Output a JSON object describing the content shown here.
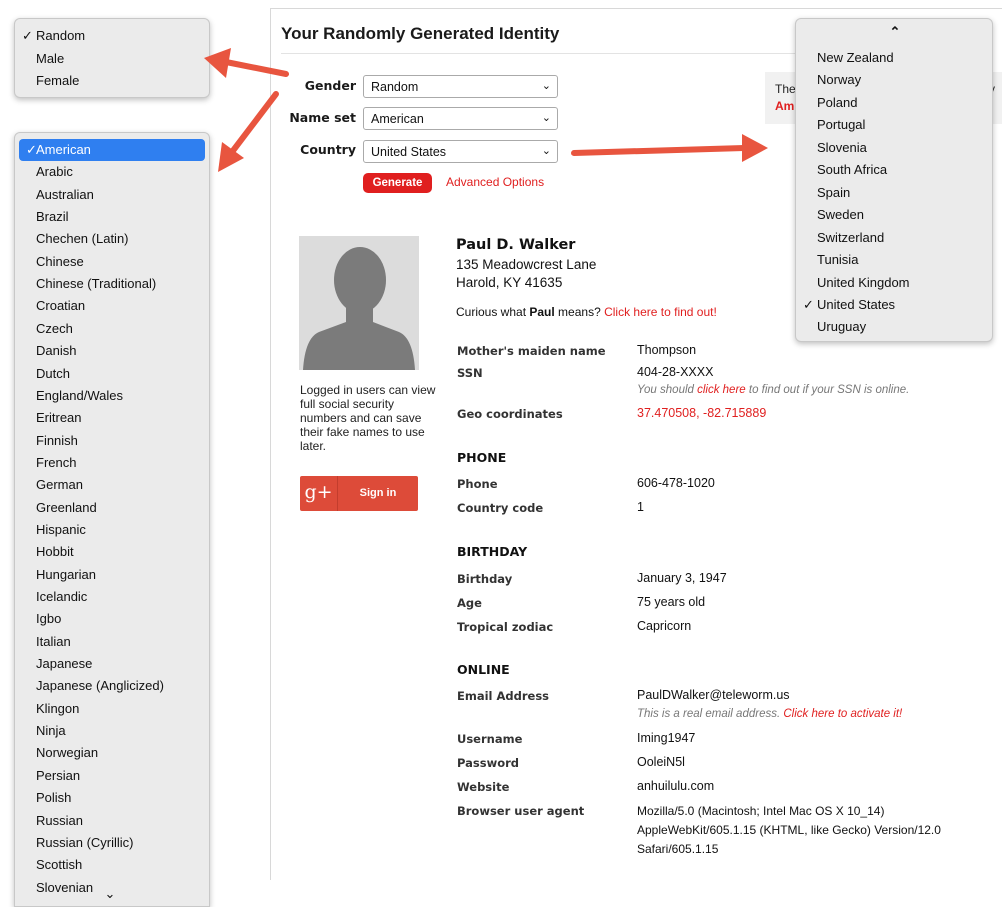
{
  "page": {
    "title": "Your Randomly Generated Identity"
  },
  "form": {
    "gender_label": "Gender",
    "gender_value": "Random",
    "nameset_label": "Name set",
    "nameset_value": "American",
    "country_label": "Country",
    "country_value": "United States",
    "generate_label": "Generate",
    "advanced_label": "Advanced Options"
  },
  "notice": {
    "line1_start": "The",
    "line1_end": "ry",
    "line2": "Am"
  },
  "sidebar": {
    "note": "Logged in users can view full social security numbers and can save their fake names to use later.",
    "gplus_glyph": "g+",
    "signin_label": "Sign in"
  },
  "identity": {
    "name": "Paul D. Walker",
    "street": "135 Meadowcrest Lane",
    "city": "Harold, KY 41635",
    "curious_prefix": "Curious what ",
    "first_name": "Paul",
    "curious_suffix": " means? ",
    "curious_link": "Click here to find out!"
  },
  "details": {
    "maiden_label": "Mother's maiden name",
    "maiden_value": "Thompson",
    "ssn_label": "SSN",
    "ssn_value": "404-28-XXXX",
    "ssn_note_prefix": "You should ",
    "ssn_note_link": "click here",
    "ssn_note_suffix": " to find out if your SSN is online.",
    "geo_label": "Geo coordinates",
    "geo_value": "37.470508, -82.715889"
  },
  "phone": {
    "heading": "PHONE",
    "phone_label": "Phone",
    "phone_value": "606-478-1020",
    "cc_label": "Country code",
    "cc_value": "1"
  },
  "birthday": {
    "heading": "BIRTHDAY",
    "birthday_label": "Birthday",
    "birthday_value": "January 3, 1947",
    "age_label": "Age",
    "age_value": "75 years old",
    "zodiac_label": "Tropical zodiac",
    "zodiac_value": "Capricorn"
  },
  "online": {
    "heading": "ONLINE",
    "email_label": "Email Address",
    "email_value": "PaulDWalker@teleworm.us",
    "email_note_prefix": "This is a real email address. ",
    "email_note_link": "Click here to activate it!",
    "username_label": "Username",
    "username_value": "Iming1947",
    "password_label": "Password",
    "password_value": "OoleiN5l",
    "website_label": "Website",
    "website_value": "anhuilulu.com",
    "ua_label": "Browser user agent",
    "ua_value": "Mozilla/5.0 (Macintosh; Intel Mac OS X 10_14) AppleWebKit/605.1.15 (KHTML, like Gecko) Version/12.0 Safari/605.1.15"
  },
  "gender_dropdown": {
    "items": [
      "Random",
      "Male",
      "Female"
    ],
    "selected": "Random"
  },
  "nameset_dropdown": {
    "items": [
      "American",
      "Arabic",
      "Australian",
      "Brazil",
      "Chechen (Latin)",
      "Chinese",
      "Chinese (Traditional)",
      "Croatian",
      "Czech",
      "Danish",
      "Dutch",
      "England/Wales",
      "Eritrean",
      "Finnish",
      "French",
      "German",
      "Greenland",
      "Hispanic",
      "Hobbit",
      "Hungarian",
      "Icelandic",
      "Igbo",
      "Italian",
      "Japanese",
      "Japanese (Anglicized)",
      "Klingon",
      "Ninja",
      "Norwegian",
      "Persian",
      "Polish",
      "Russian",
      "Russian (Cyrillic)",
      "Scottish",
      "Slovenian"
    ],
    "selected": "American",
    "highlight_color": "#2f7ff0"
  },
  "country_dropdown": {
    "items": [
      "New Zealand",
      "Norway",
      "Poland",
      "Portugal",
      "Slovenia",
      "South Africa",
      "Spain",
      "Sweden",
      "Switzerland",
      "Tunisia",
      "United Kingdom",
      "United States",
      "Uruguay"
    ],
    "selected": "United States"
  },
  "glyphs": {
    "check": "✓",
    "chevron_down": "⌄",
    "chevron_up": "⌃",
    "scroll_down": "⌄"
  },
  "colors": {
    "accent_red": "#e01f1f",
    "arrow_red": "#e8553f",
    "gplus_red": "#dd4b39"
  }
}
